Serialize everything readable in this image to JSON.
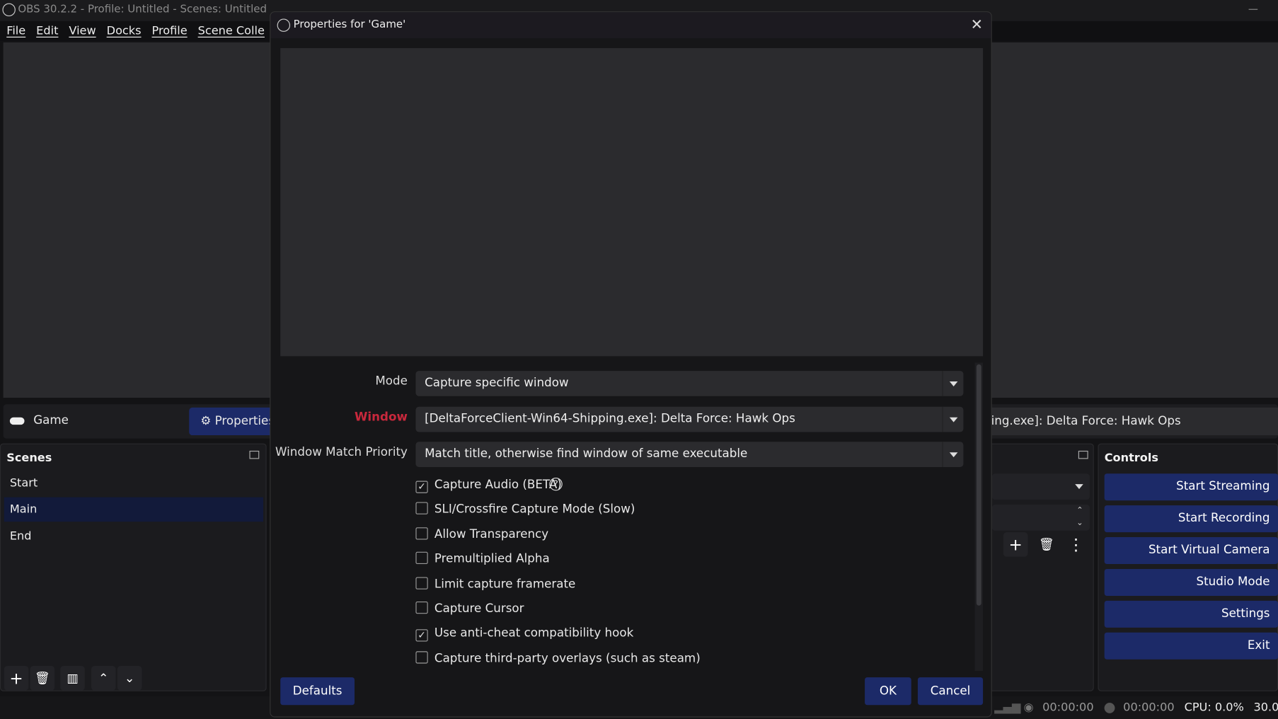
{
  "app": {
    "title": "OBS 30.2.2 - Profile: Untitled - Scenes: Untitled",
    "menu": [
      "File",
      "Edit",
      "View",
      "Docks",
      "Profile",
      "Scene Colle"
    ]
  },
  "source_bar": {
    "source_name": "Game",
    "properties_label": "Properties",
    "window_value_partial": "ing.exe]: Delta Force: Hawk Ops"
  },
  "scenes": {
    "title": "Scenes",
    "items": [
      "Start",
      "Main",
      "End"
    ],
    "selected": "Main"
  },
  "controls": {
    "title": "Controls",
    "buttons": [
      "Start Streaming",
      "Start Recording",
      "Start Virtual Camera",
      "Studio Mode",
      "Settings",
      "Exit"
    ]
  },
  "status": {
    "stream_time": "00:00:00",
    "record_time": "00:00:00",
    "cpu": "CPU: 0.0%",
    "fps": "30.0"
  },
  "dialog": {
    "title": "Properties for 'Game'",
    "mode_label": "Mode",
    "mode_value": "Capture specific window",
    "window_label": "Window",
    "window_value": "[DeltaForceClient-Win64-Shipping.exe]: Delta Force: Hawk Ops",
    "priority_label": "Window Match Priority",
    "priority_value": "Match title, otherwise find window of same executable",
    "checkboxes": [
      {
        "label": "Capture Audio (BETA)",
        "checked": true
      },
      {
        "label": "SLI/Crossfire Capture Mode (Slow)",
        "checked": false
      },
      {
        "label": "Allow Transparency",
        "checked": false
      },
      {
        "label": "Premultiplied Alpha",
        "checked": false
      },
      {
        "label": "Limit capture framerate",
        "checked": false
      },
      {
        "label": "Capture Cursor",
        "checked": false
      },
      {
        "label": "Use anti-cheat compatibility hook",
        "checked": true
      },
      {
        "label": "Capture third-party overlays (such as steam)",
        "checked": false
      }
    ],
    "defaults_label": "Defaults",
    "ok_label": "OK",
    "cancel_label": "Cancel"
  },
  "colors": {
    "accent": "#1c2a68",
    "warning_label": "#c8283c",
    "background": "#161618"
  }
}
